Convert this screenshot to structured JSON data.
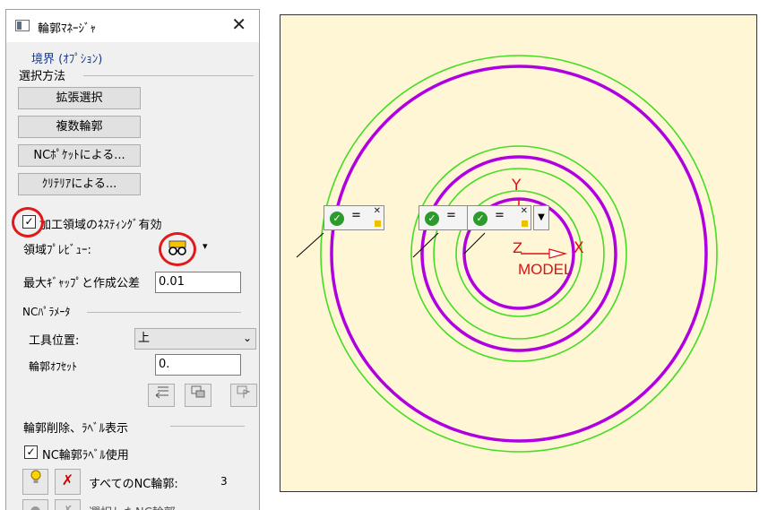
{
  "window": {
    "title": "輪郭ﾏﾈｰｼﾞｬ",
    "close_glyph": "✕"
  },
  "boundary_label": "境界 (ｵﾌﾟｼｮﾝ)",
  "select_method": {
    "heading": "選択方法",
    "buttons": [
      "拡張選択",
      "複数輪郭",
      "NCﾎﾟｹｯﾄによる...",
      "ｸﾘﾃﾘｱによる..."
    ]
  },
  "nesting": {
    "label": "加工領域のﾈｽﾃｨﾝｸﾞ有効",
    "checked": "✓"
  },
  "region_preview": {
    "label": "領域ﾌﾟﾚﾋﾞｭｰ:",
    "arrow": "▾"
  },
  "max_gap": {
    "label": "最大ｷﾞｬｯﾌﾟと作成公差",
    "value": "0.01"
  },
  "nc_params": {
    "heading": "NCﾊﾟﾗﾒｰﾀ",
    "tool_position_label": "工具位置:",
    "tool_position_value": "上",
    "contour_offset_label": "輪郭ｵﾌｾｯﾄ",
    "contour_offset_value": "0."
  },
  "labels_section": {
    "heading": "輪郭削除、ﾗﾍﾞﾙ表示",
    "use_nc_label": "NC輪郭ﾗﾍﾞﾙ使用",
    "use_nc_checked": "✓",
    "all_nc_label": "すべてのNC輪郭:",
    "all_nc_count": "3",
    "selected_label": "選択したNC輪郭:"
  },
  "canvas": {
    "axis_y": "Y",
    "axis_x": "X",
    "axis_z": "Z",
    "model_label": "MODEL",
    "tag_eq": "=",
    "tag_close": "✕",
    "dropdown_arrow": "▼",
    "colors": {
      "background": "#fff6d6",
      "contour": "#b000e0",
      "offset": "#44dd22",
      "axis": "#e01010"
    }
  }
}
